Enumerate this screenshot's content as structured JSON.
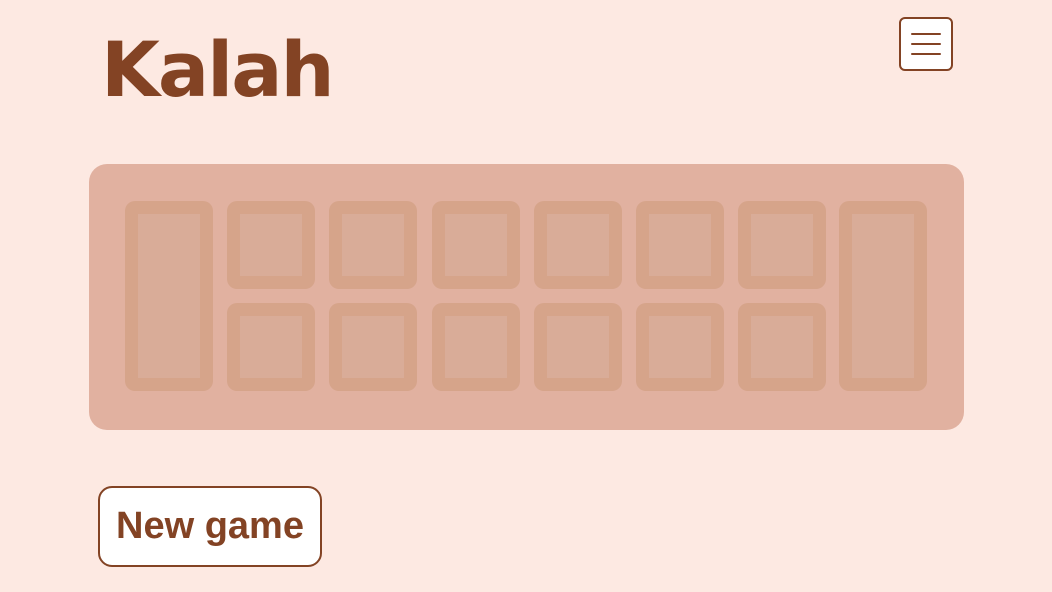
{
  "header": {
    "title": "Kalah",
    "menu_icon": "hamburger-menu-icon"
  },
  "board": {
    "pits_per_side": 6,
    "stores": 2,
    "colors": {
      "board": "#e1b1a0",
      "pit_border": "#d6a48a",
      "pit_fill": "#d9ac98"
    }
  },
  "actions": {
    "new_game_label": "New game"
  },
  "colors": {
    "background": "#fde9e2",
    "accent": "#834324"
  }
}
